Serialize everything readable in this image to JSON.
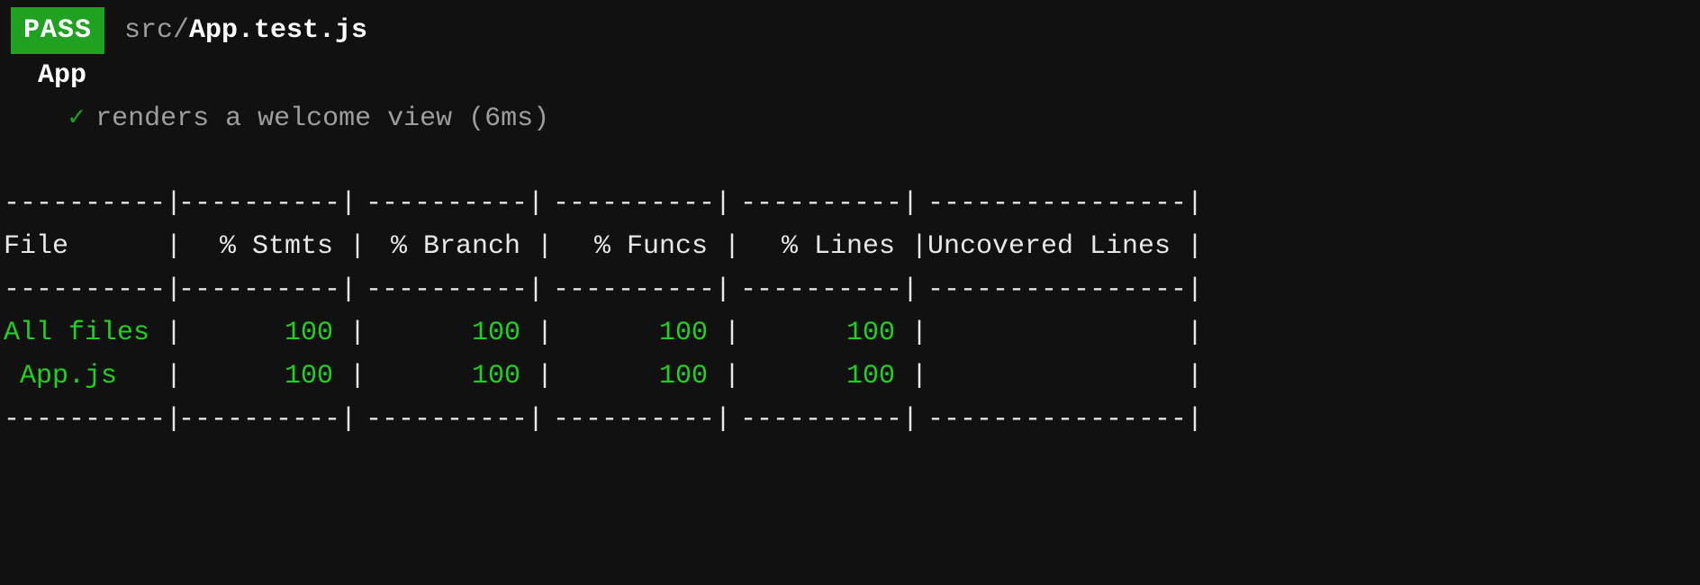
{
  "run": {
    "status_badge": "PASS",
    "path_dir": "src/",
    "path_file": "App.test.js"
  },
  "suite": {
    "name": "App",
    "tests": [
      {
        "check": "✓",
        "desc": "renders a welcome view",
        "timing": "(6ms)"
      }
    ]
  },
  "coverage": {
    "headers": [
      "File",
      "% Stmts",
      "% Branch",
      "% Funcs",
      "% Lines",
      "Uncovered Lines"
    ],
    "rows": [
      {
        "file": "All files",
        "stmts": "100",
        "branch": "100",
        "funcs": "100",
        "lines": "100",
        "uncov": ""
      },
      {
        "file": " App.js",
        "stmts": "100",
        "branch": "100",
        "funcs": "100",
        "lines": "100",
        "uncov": ""
      }
    ]
  },
  "colors": {
    "pass_bg": "#21a121",
    "green_text": "#21d121",
    "dim": "#9e9e9e"
  }
}
